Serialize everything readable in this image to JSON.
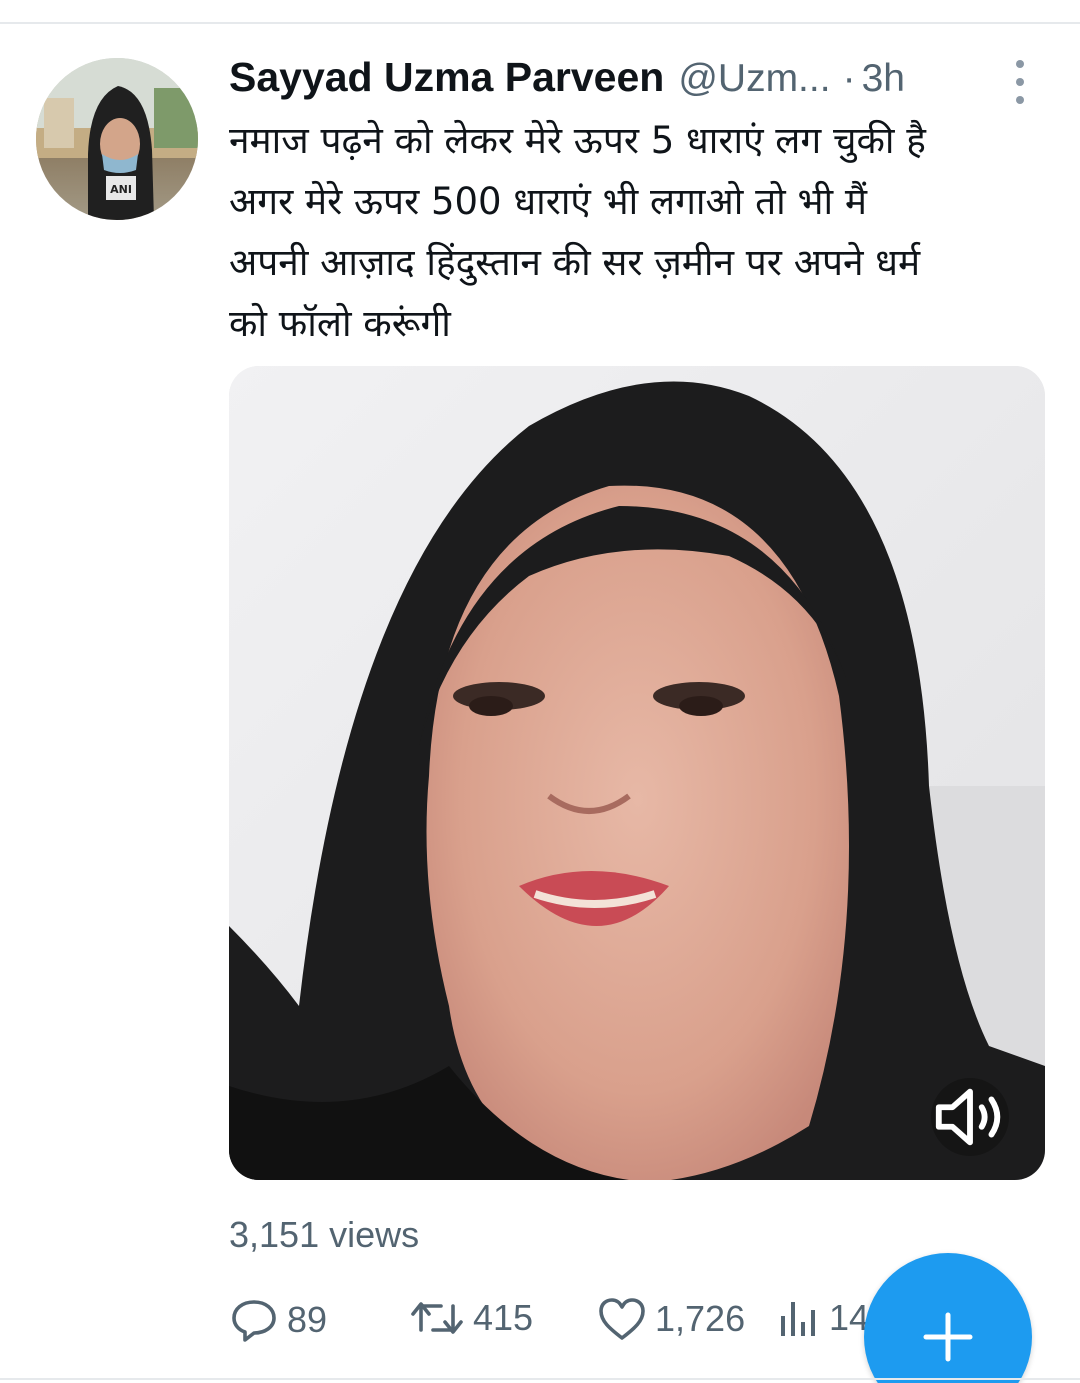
{
  "tweet": {
    "author": {
      "display_name": "Sayyad Uzma Parveen",
      "handle": "@Uzm...",
      "avatar_badge": "ANI"
    },
    "separator": "·",
    "time": "3h",
    "text_lines": [
      "नमाज पढ़ने को लेकर मेरे ऊपर 5 धाराएं लग चुकी है",
      "अगर मेरे ऊपर 500 धाराएं भी लगाओ तो भी मैं",
      "अपनी आज़ाद हिंदुस्तान की सर ज़मीन पर अपने धर्म",
      "को फॉलो करूंगी"
    ],
    "views": "3,151 views",
    "actions": {
      "replies": "89",
      "retweets": "415",
      "likes": "1,726",
      "analytics": "14"
    }
  },
  "icons": {
    "more": "more-vertical-icon",
    "volume": "volume-icon",
    "reply": "reply-icon",
    "retweet": "retweet-icon",
    "like": "heart-icon",
    "analytics": "analytics-icon",
    "compose": "plus-icon"
  },
  "colors": {
    "accent": "#1d9bf0",
    "secondary_text": "#536471",
    "primary_text": "#0f1419"
  }
}
